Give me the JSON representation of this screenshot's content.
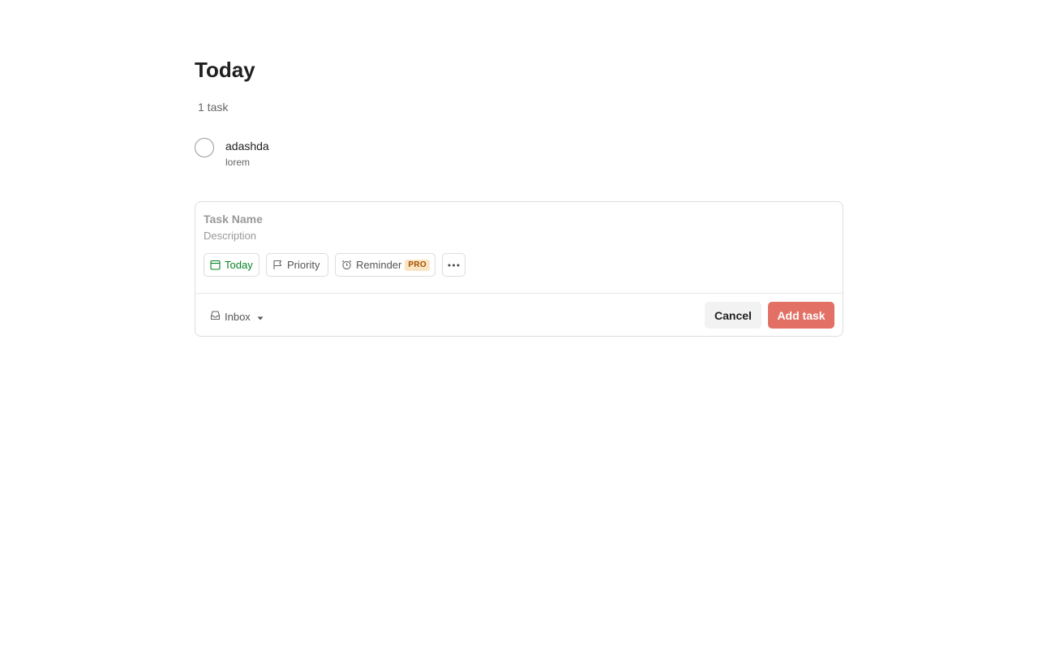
{
  "view": {
    "title": "Today",
    "task_count": "1 task"
  },
  "tasks": [
    {
      "title": "adashda",
      "description": "lorem"
    }
  ],
  "editor": {
    "task_name_placeholder": "Task Name",
    "description_placeholder": "Description",
    "chips": {
      "today_label": "Today",
      "priority_label": "Priority",
      "reminder_label": "Reminder",
      "reminder_badge": "PRO"
    },
    "project": "Inbox",
    "cancel_label": "Cancel",
    "add_label": "Add task"
  },
  "colors": {
    "accent": "#e27065",
    "today_green": "#058527",
    "pro_badge_bg": "#fbe4c4",
    "pro_badge_text": "#a35200"
  },
  "icons": {
    "today_chip": "calendar-icon",
    "priority_chip": "flag-icon",
    "reminder_chip": "alarm-clock-icon",
    "more_chip": "more-dots-icon",
    "project": "inbox-icon",
    "project_caret": "chevron-down-icon"
  }
}
